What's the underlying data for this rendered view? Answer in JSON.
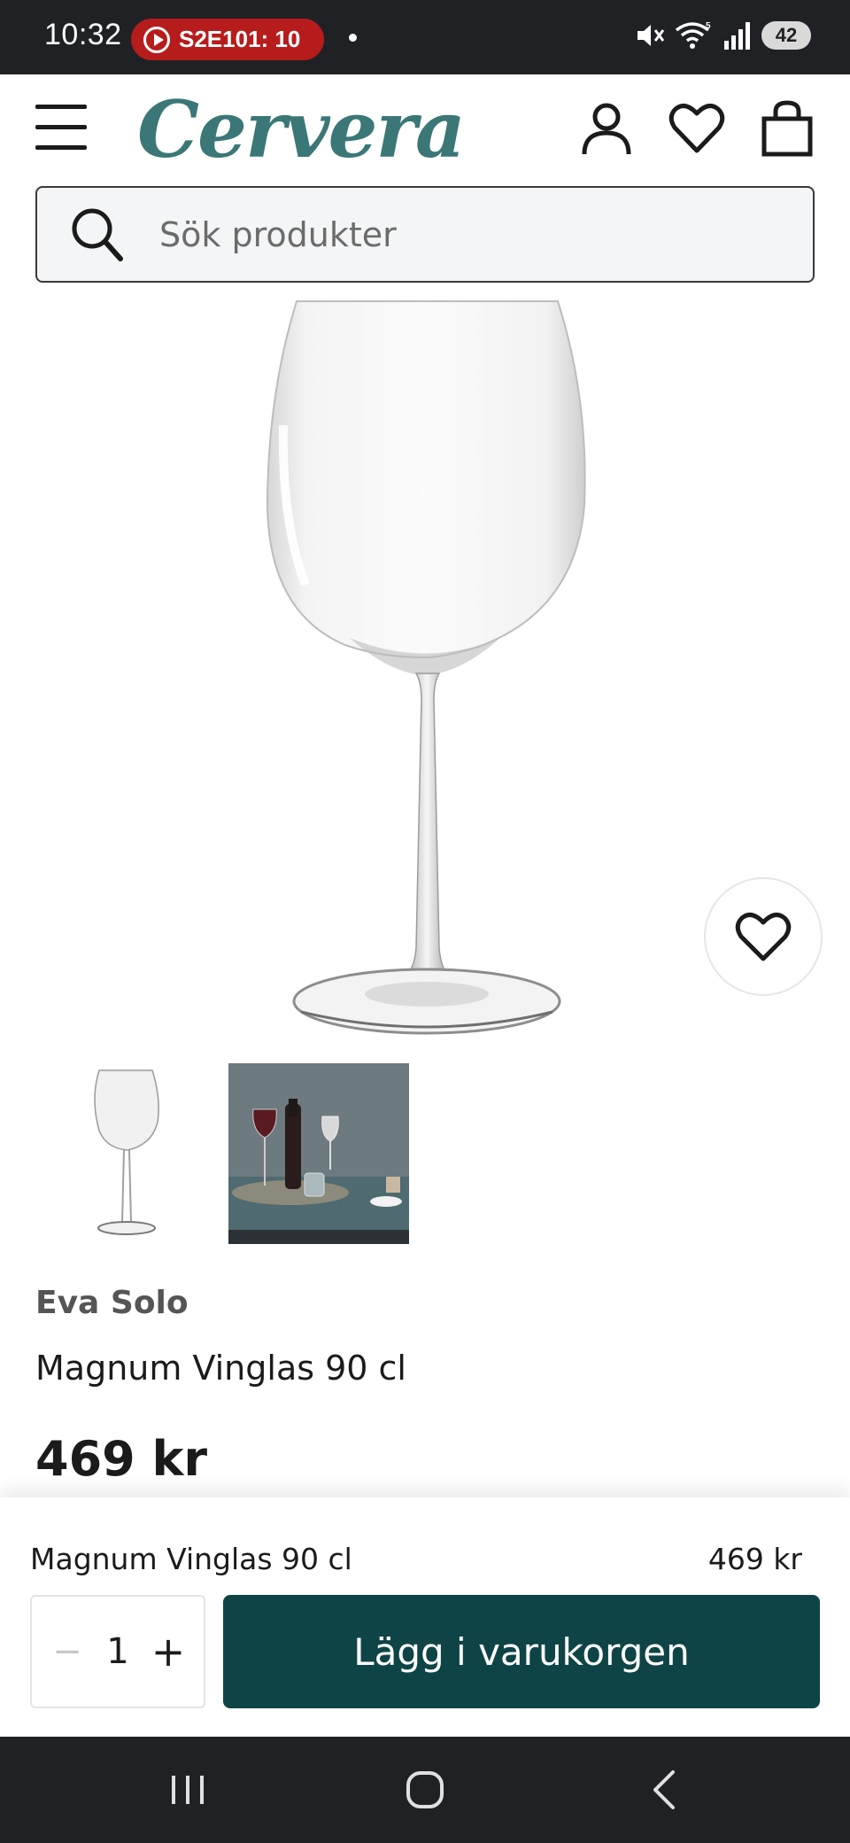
{
  "status_bar": {
    "time": "10:32",
    "recording_label": "S2E101: 10",
    "battery": "42"
  },
  "header": {
    "logo": "Cervera"
  },
  "search": {
    "placeholder": "Sök produkter"
  },
  "product": {
    "brand": "Eva Solo",
    "name": "Magnum Vinglas 90 cl",
    "price": "469 kr"
  },
  "buy_bar": {
    "name": "Magnum Vinglas 90 cl",
    "price": "469 kr",
    "quantity": "1",
    "minus": "−",
    "plus": "+",
    "add_to_cart": "Lägg i varukorgen"
  },
  "colors": {
    "brand": "#3b7777",
    "cta": "#0f4446",
    "status_bar": "#202124",
    "recording": "#b71c1c"
  }
}
